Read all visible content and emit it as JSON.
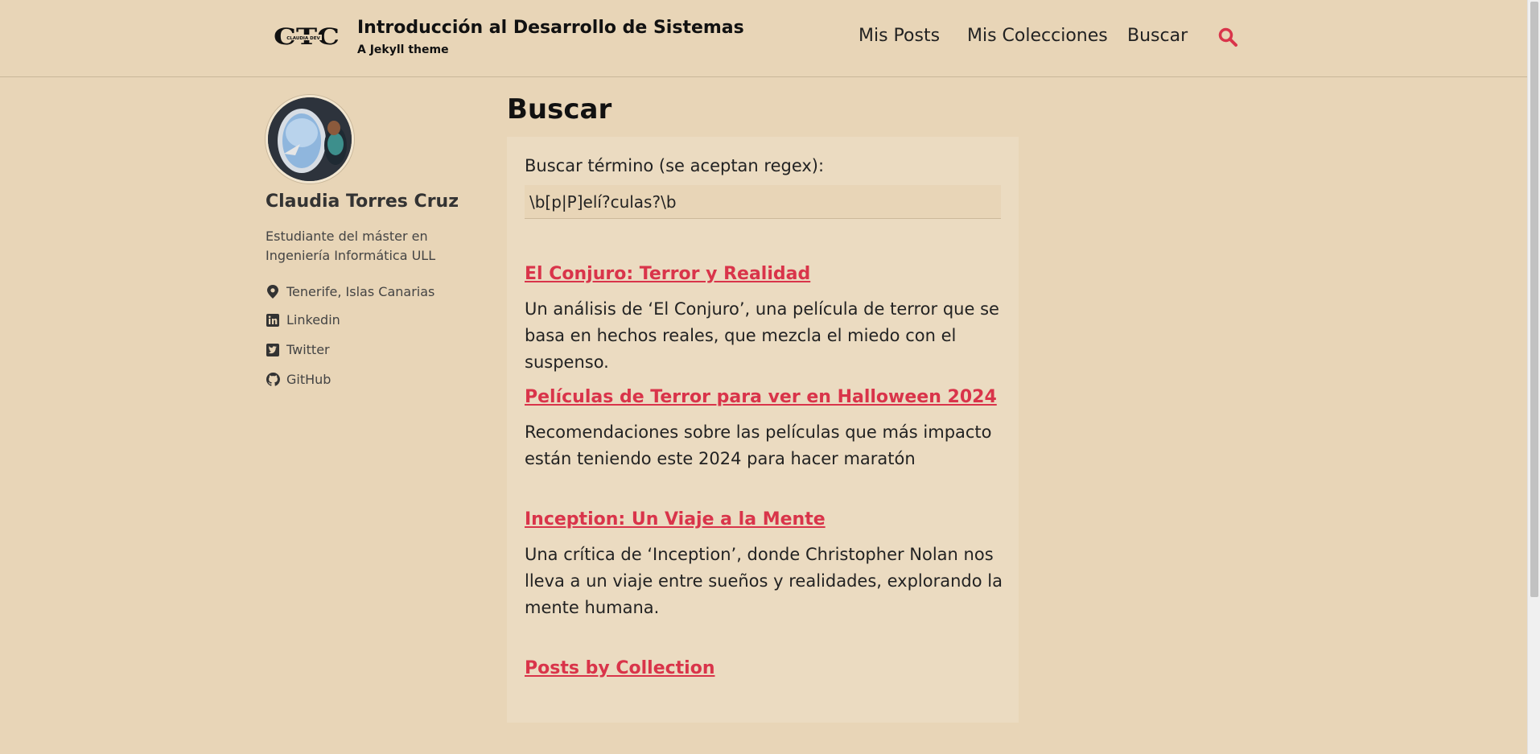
{
  "header": {
    "logo_text": "CTC",
    "logo_subtext": "CLAUDIA DEV",
    "title": "Introducción al Desarrollo de Sistemas",
    "subtitle": "A Jekyll theme",
    "nav": [
      {
        "label": "Mis Posts"
      },
      {
        "label": "Mis Colecciones"
      },
      {
        "label": "Buscar"
      }
    ],
    "search_icon": "search-icon",
    "accent_color": "#d9344a"
  },
  "sidebar": {
    "name": "Claudia Torres Cruz",
    "bio": "Estudiante del máster en Ingeniería Informática ULL",
    "links": [
      {
        "icon": "location-icon",
        "label": "Tenerife, Islas Canarias"
      },
      {
        "icon": "linkedin-icon",
        "label": "Linkedin"
      },
      {
        "icon": "twitter-icon",
        "label": "Twitter"
      },
      {
        "icon": "github-icon",
        "label": "GitHub"
      }
    ]
  },
  "main": {
    "title": "Buscar",
    "search_label": "Buscar término (se aceptan regex):",
    "search_value": "\\b[p|P]elí?culas?\\b",
    "results": [
      {
        "title": "El Conjuro: Terror y Realidad",
        "excerpt": "Un análisis de ‘El Conjuro’, una película de terror que se basa en hechos reales, que mezcla el miedo con el suspenso."
      },
      {
        "title": "Películas de Terror para ver en Halloween 2024",
        "excerpt": "Recomendaciones sobre las películas que más impacto están teniendo este 2024 para hacer maratón"
      },
      {
        "title": "Inception: Un Viaje a la Mente",
        "excerpt": "Una crítica de ‘Inception’, donde Christopher Nolan nos lleva a un viaje entre sueños y realidades, explorando la mente humana."
      },
      {
        "title": "Posts by Collection",
        "excerpt": ""
      }
    ]
  },
  "colors": {
    "background": "#e8d5b7",
    "panel": "#ebdbc1",
    "link": "#d9344a"
  }
}
